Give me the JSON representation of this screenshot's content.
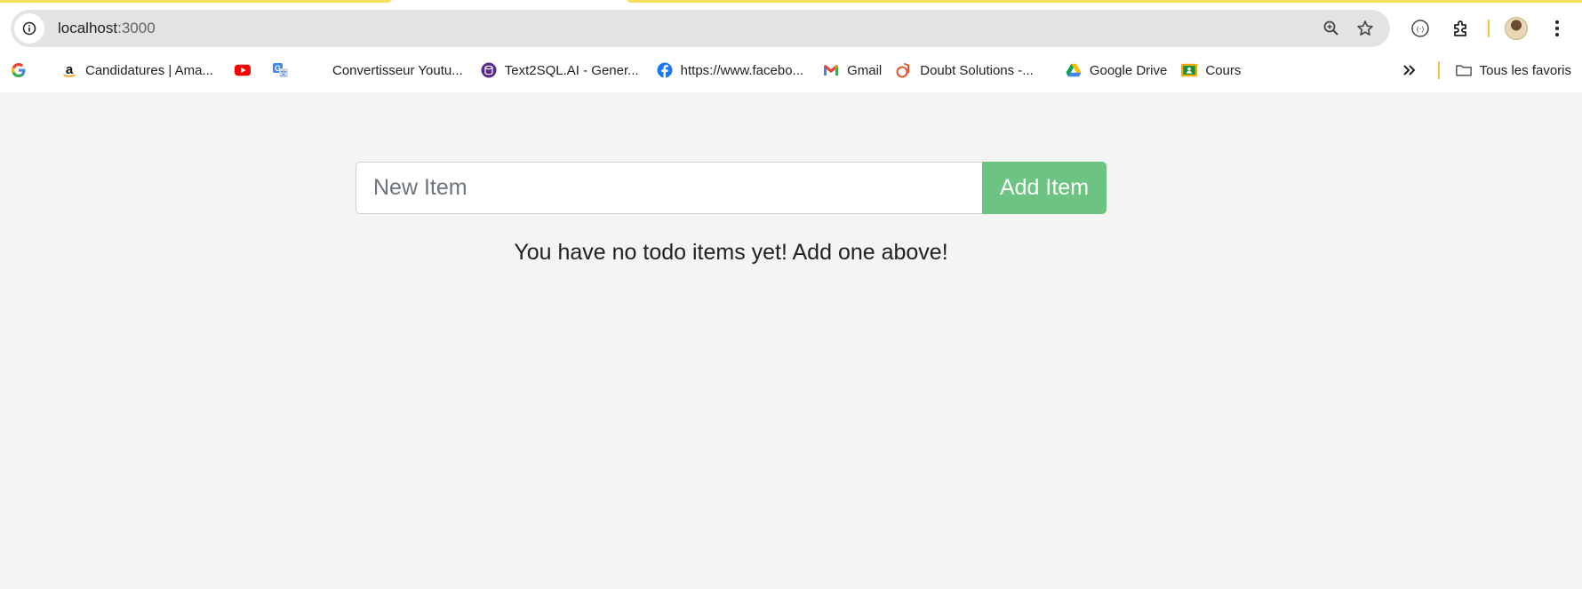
{
  "browser": {
    "url_host": "localhost",
    "url_port": ":3000",
    "accent_color": "#f6e05e"
  },
  "bookmarks": [
    {
      "label": "",
      "icon": "google-icon"
    },
    {
      "label": "Candidatures | Ama...",
      "icon": "amazon-icon"
    },
    {
      "label": "",
      "icon": "youtube-icon"
    },
    {
      "label": "",
      "icon": "translate-icon"
    },
    {
      "label": "Convertisseur Youtu...",
      "icon": "blank-page-icon"
    },
    {
      "label": "Text2SQL.AI - Gener...",
      "icon": "text2sql-icon"
    },
    {
      "label": "https://www.facebo...",
      "icon": "facebook-icon"
    },
    {
      "label": "Gmail",
      "icon": "gmail-icon"
    },
    {
      "label": "Doubt Solutions -...",
      "icon": "doubt-icon"
    },
    {
      "label": "Google Drive",
      "icon": "drive-icon"
    },
    {
      "label": "Cours",
      "icon": "classroom-icon"
    }
  ],
  "bookmarks_right": {
    "all_bookmarks_label": "Tous les favoris"
  },
  "todo": {
    "input_placeholder": "New Item",
    "input_value": "",
    "add_button_label": "Add Item",
    "empty_message": "You have no todo items yet! Add one above!",
    "button_color": "#6cc382"
  }
}
